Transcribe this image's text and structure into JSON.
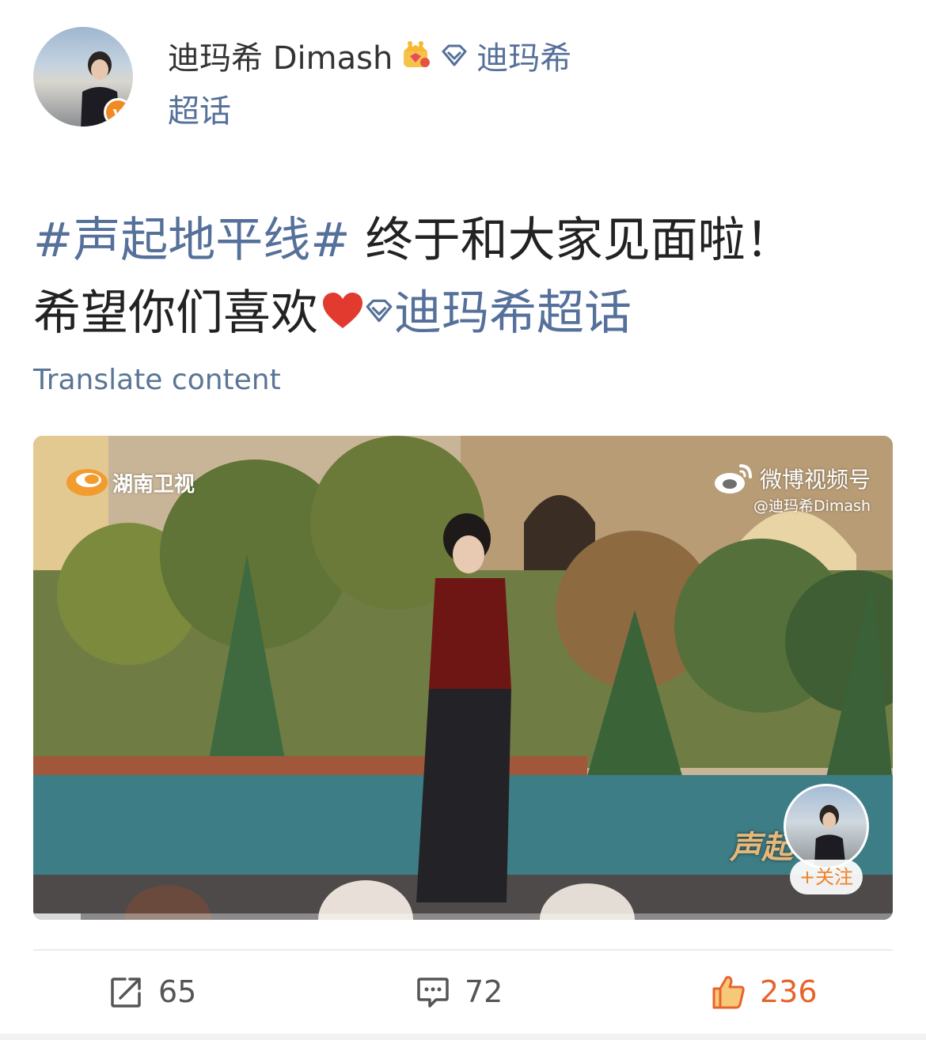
{
  "author": {
    "name": "迪玛希 Dimash",
    "topic_label": "迪玛希",
    "topic_suffix": "超话"
  },
  "post": {
    "hashtag": "#声起地平线#",
    "text_part1": " 终于和大家见面啦！",
    "text_part2": "希望你们喜欢",
    "topic_link": "迪玛希超话",
    "translate_label": "Translate content"
  },
  "video": {
    "watermark_left": "湖南卫视",
    "watermark_right": "微博视频号",
    "watermark_handle": "@迪玛希Dimash",
    "show_logo": "声起",
    "follow_label": "+关注",
    "progress": 0.055
  },
  "actions": {
    "repost_count": "65",
    "comment_count": "72",
    "like_count": "236"
  },
  "colors": {
    "link": "#55709a",
    "like": "#e8632c",
    "verified": "#f08a24"
  }
}
